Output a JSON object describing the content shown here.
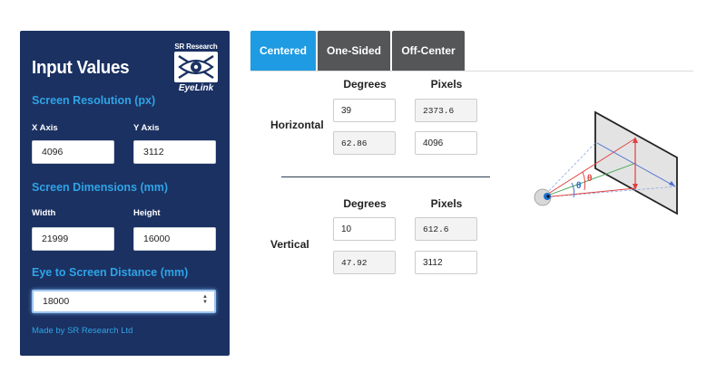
{
  "panel": {
    "title": "Input Values",
    "logo": {
      "top": "SR Research",
      "bottom": "EyeLink"
    },
    "screen_resolution": {
      "heading": "Screen Resolution (px)",
      "x_label": "X Axis",
      "x_value": "4096",
      "y_label": "Y Axis",
      "y_value": "3112"
    },
    "screen_dimensions": {
      "heading": "Screen Dimensions (mm)",
      "width_label": "Width",
      "width_value": "21999",
      "height_label": "Height",
      "height_value": "16000"
    },
    "distance": {
      "heading": "Eye to Screen Distance (mm)",
      "value": "18000"
    },
    "credit": "Made by SR Research Ltd"
  },
  "tabs": [
    {
      "label": "Centered",
      "active": true
    },
    {
      "label": "One-Sided",
      "active": false
    },
    {
      "label": "Off-Center",
      "active": false
    }
  ],
  "results": {
    "degrees_header": "Degrees",
    "pixels_header": "Pixels",
    "horizontal": {
      "label": "Horizontal",
      "degrees_input": "39",
      "degrees_output": "62.86",
      "pixels_output": "2373.6",
      "pixels_input": "4096"
    },
    "vertical": {
      "label": "Vertical",
      "degrees_input": "10",
      "degrees_output": "47.92",
      "pixels_output": "612.6",
      "pixels_input": "3112"
    }
  },
  "illustration": {
    "angle_symbol": "θ"
  },
  "colors": {
    "panel_bg": "#1b3162",
    "accent_blue": "#2fa4e6",
    "tab_active": "#1e9be2",
    "tab_inactive": "#545658"
  }
}
